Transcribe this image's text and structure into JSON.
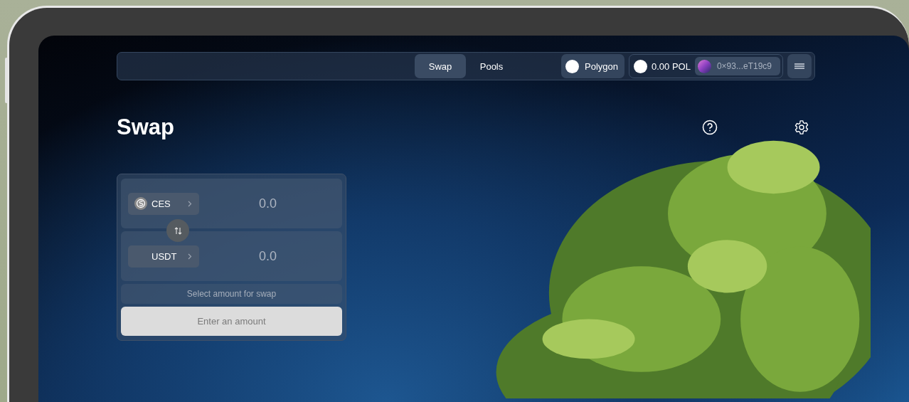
{
  "nav": {
    "tabs": [
      {
        "label": "Swap",
        "selected": true
      },
      {
        "label": "Pools",
        "selected": false
      }
    ],
    "network": {
      "label": "Polygon"
    },
    "balance": "0.00 POL",
    "address": "0×93...eT19c9"
  },
  "page": {
    "title": "Swap"
  },
  "swap": {
    "tokens": [
      {
        "symbol": "CES",
        "amount": "0.0",
        "has_icon": true
      },
      {
        "symbol": "USDT",
        "amount": "0.0",
        "has_icon": false
      }
    ],
    "hint": "Select amount for swap",
    "submit": {
      "label": "Enter an amount",
      "disabled": true
    }
  }
}
